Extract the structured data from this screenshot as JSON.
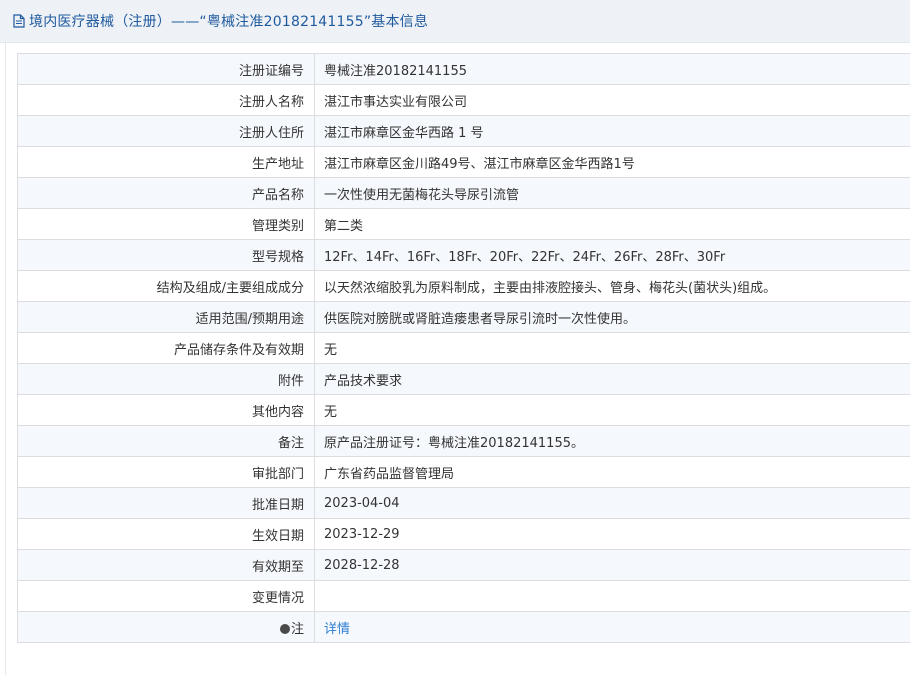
{
  "header": {
    "title": "境内医疗器械（注册）——“粤械注准20182141155”基本信息"
  },
  "rows": [
    {
      "label": "注册证编号",
      "value": "粤械注准20182141155"
    },
    {
      "label": "注册人名称",
      "value": "湛江市事达实业有限公司"
    },
    {
      "label": "注册人住所",
      "value": "湛江市麻章区金华西路 1 号"
    },
    {
      "label": "生产地址",
      "value": "湛江市麻章区金川路49号、湛江市麻章区金华西路1号"
    },
    {
      "label": "产品名称",
      "value": "一次性使用无菌梅花头导尿引流管"
    },
    {
      "label": "管理类别",
      "value": "第二类"
    },
    {
      "label": "型号规格",
      "value": "12Fr、14Fr、16Fr、18Fr、20Fr、22Fr、24Fr、26Fr、28Fr、30Fr"
    },
    {
      "label": "结构及组成/主要组成成分",
      "value": "以天然浓缩胶乳为原料制成，主要由排液腔接头、管身、梅花头(菌状头)组成。"
    },
    {
      "label": "适用范围/预期用途",
      "value": "供医院对膀胱或肾脏造瘘患者导尿引流时一次性使用。"
    },
    {
      "label": "产品储存条件及有效期",
      "value": "无"
    },
    {
      "label": "附件",
      "value": "产品技术要求"
    },
    {
      "label": "其他内容",
      "value": "无"
    },
    {
      "label": "备注",
      "value": "原产品注册证号：粤械注准20182141155。"
    },
    {
      "label": "审批部门",
      "value": "广东省药品监督管理局"
    },
    {
      "label": "批准日期",
      "value": "2023-04-04"
    },
    {
      "label": "生效日期",
      "value": "2023-12-29"
    },
    {
      "label": "有效期至",
      "value": "2028-12-28"
    },
    {
      "label": "变更情况",
      "value": ""
    },
    {
      "label": "注",
      "value": "详情"
    }
  ],
  "colors": {
    "header_bg": "#eef1f6",
    "title": "#1f5a9e",
    "row_alt": "#f5f8fc",
    "link": "#2f7fd2"
  },
  "icons": {
    "header": "document-icon",
    "note": "info-dot-icon"
  }
}
